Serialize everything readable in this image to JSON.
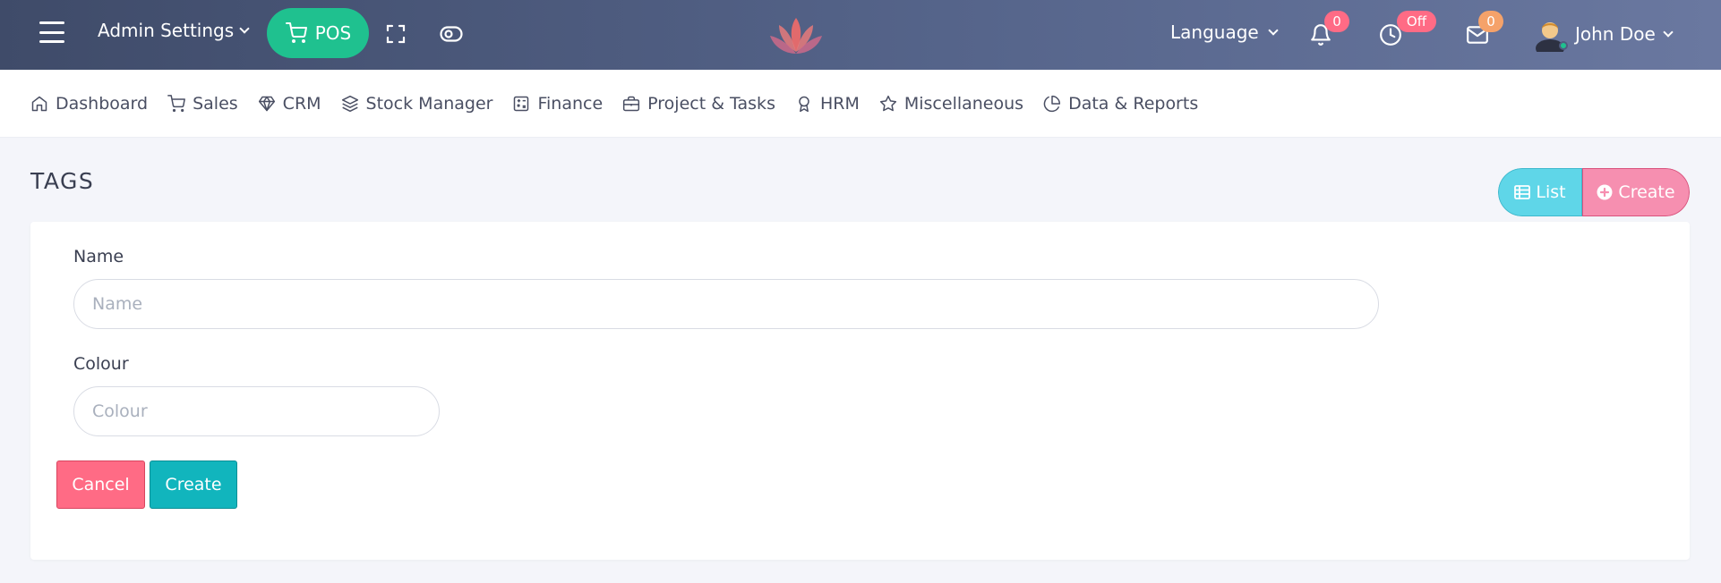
{
  "topbar": {
    "admin_settings_label": "Admin Settings",
    "pos_label": "POS",
    "language_label": "Language",
    "notifications_count": "0",
    "clock_status": "Off",
    "messages_count": "0",
    "user_name": "John Doe"
  },
  "nav": {
    "items": [
      {
        "label": "Dashboard",
        "icon": "home-icon"
      },
      {
        "label": "Sales",
        "icon": "cart-icon"
      },
      {
        "label": "CRM",
        "icon": "diamond-icon"
      },
      {
        "label": "Stock Manager",
        "icon": "layers-icon"
      },
      {
        "label": "Finance",
        "icon": "calculator-icon"
      },
      {
        "label": "Project & Tasks",
        "icon": "briefcase-icon"
      },
      {
        "label": "HRM",
        "icon": "award-icon"
      },
      {
        "label": "Miscellaneous",
        "icon": "star-icon"
      },
      {
        "label": "Data & Reports",
        "icon": "pie-chart-icon"
      }
    ]
  },
  "page": {
    "title": "TAGS",
    "list_button": "List",
    "create_button": "Create"
  },
  "form": {
    "name_label": "Name",
    "name_placeholder": "Name",
    "name_value": "",
    "colour_label": "Colour",
    "colour_placeholder": "Colour",
    "colour_value": "",
    "cancel_label": "Cancel",
    "submit_label": "Create"
  },
  "colors": {
    "pos_green": "#1fc18f",
    "badge_pink": "#ff6b85",
    "badge_orange": "#f5a26a",
    "list_cyan": "#5fd6e8",
    "create_pink": "#f68fb0",
    "cancel_red": "#ff6b85",
    "submit_teal": "#11b5bd"
  }
}
